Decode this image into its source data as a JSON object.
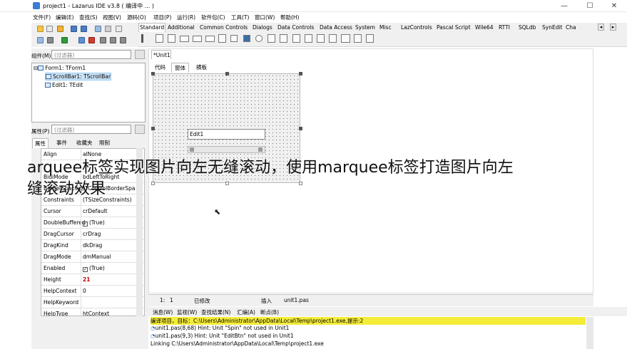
{
  "window": {
    "title": "project1 - Lazarus IDE v3.8 ( 编译中 ... )",
    "controls": [
      "—",
      "☐",
      "✕"
    ]
  },
  "menu": [
    "文件(F)",
    "编辑(E)",
    "查找(S)",
    "视图(V)",
    "源码(O)",
    "项目(P)",
    "运行(R)",
    "软件包(C)",
    "工具(T)",
    "窗口(W)",
    "帮助(H)"
  ],
  "palette": {
    "tabs": [
      "Standard",
      "Additional",
      "Common Controls",
      "Dialogs",
      "Data Controls",
      "Data Access",
      "System",
      "Misc",
      "LazControls",
      "Pascal Script",
      "Wile64",
      "RTTI",
      "SQLdb",
      "SynEdit",
      "Cha"
    ],
    "scroll_left": "◂",
    "scroll_right": "▸"
  },
  "components_panel": {
    "label": "组件(M)",
    "filter_placeholder": "(过滤器)",
    "tree": [
      {
        "label": "Form1: TForm1",
        "expander": "⊟"
      },
      {
        "label": "ScrollBar1: TScrollBar"
      },
      {
        "label": "Edit1: TEdit"
      }
    ]
  },
  "properties_panel": {
    "label": "属性(P)",
    "filter_placeholder": "(过滤器)",
    "tabs": [
      "属性",
      "事件",
      "收藏夹",
      "限制"
    ],
    "rows": [
      {
        "name": "Align",
        "value": "alNone"
      },
      {
        "name": "",
        "value": ""
      },
      {
        "name": "BidiMode",
        "value": "bdLeftToRight"
      },
      {
        "name": "BorderSpacing",
        "value": "(TControlBorderSpa"
      },
      {
        "name": "Constraints",
        "value": "(TSizeConstraints)"
      },
      {
        "name": "Cursor",
        "value": "crDefault"
      },
      {
        "name": "DoubleBuffered",
        "value": "(True)",
        "checked": true
      },
      {
        "name": "DragCursor",
        "value": "crDrag"
      },
      {
        "name": "DragKind",
        "value": "dkDrag"
      },
      {
        "name": "DragMode",
        "value": "dmManual"
      },
      {
        "name": "Enabled",
        "value": "(True)",
        "checked": true
      },
      {
        "name": "Height",
        "value": "21",
        "highlight": true
      },
      {
        "name": "HelpContext",
        "value": "0"
      },
      {
        "name": "HelpKeyword",
        "value": ""
      },
      {
        "name": "HelpType",
        "value": "htContext"
      }
    ]
  },
  "editor": {
    "file_tab": "*Unit1",
    "view_tabs": [
      "代码",
      "窗体",
      "横板"
    ],
    "edit1_text": "Edit1"
  },
  "status": {
    "line": "1:",
    "col": "1",
    "modified": "已修改",
    "mode": "插入",
    "file": "unit1.pas"
  },
  "messages": {
    "tabs": [
      "消息(W)",
      "监视(W)",
      "查找结果(N)",
      "汇编(A)",
      "断点(B)"
    ],
    "lines": [
      "编译项目，目标：C:\\Users\\Administrator\\AppData\\Local\\Temp\\project1.exe,提示:2",
      "unit1.pas(8,68) Hint: Unit \"Spin\" not used in Unit1",
      "unit1.pas(9,3) Hint: Unit \"EditBtn\" not used in Unit1",
      "Linking C:\\Users\\Administrator\\AppData\\Local\\Temp\\project1.exe"
    ]
  },
  "overlay_caption": {
    "line1": "arquee标签实现图片向左无缝滚动，使用marquee标签打造图片向左",
    "line2": "缝滚动效果"
  },
  "colors": {
    "highlight_row": "#f5ec3a",
    "selected_tree": "#cce4f7",
    "height_value": "#c00000"
  }
}
